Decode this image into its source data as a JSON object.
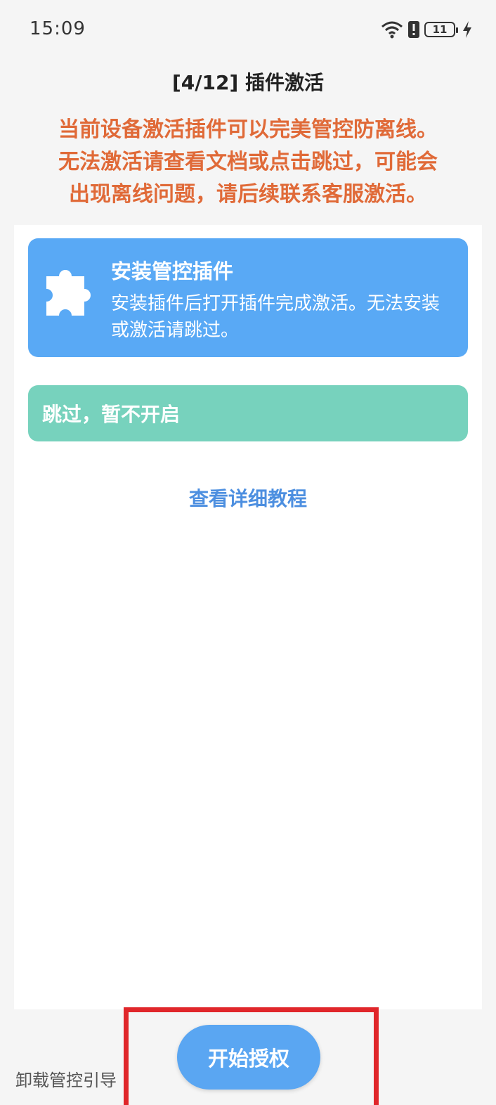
{
  "status_bar": {
    "time": "15:09",
    "battery_level": "11",
    "icons": [
      "wifi-icon",
      "alert-icon",
      "battery-icon",
      "charging-icon"
    ]
  },
  "page": {
    "title": "[4/12] 插件激活",
    "warning_lines": [
      "当前设备激活插件可以完美管控防离线。",
      "无法激活请查看文档或点击跳过，可能会",
      "出现离线问题，请后续联系客服激活。"
    ]
  },
  "install_card": {
    "icon": "puzzle-icon",
    "title": "安装管控插件",
    "description": "安装插件后打开插件完成激活。无法安装或激活请跳过。"
  },
  "skip_card": {
    "label": "跳过，暂不开启"
  },
  "tutorial_link": "查看详细教程",
  "footer": {
    "uninstall_label": "卸载管控引导",
    "start_button": "开始授权"
  },
  "colors": {
    "warning": "#e06a38",
    "install_card": "#59a9f5",
    "skip_card": "#77d2bd",
    "link": "#4d8fe0",
    "start_button": "#5aa6f2",
    "highlight": "#e0262a"
  }
}
